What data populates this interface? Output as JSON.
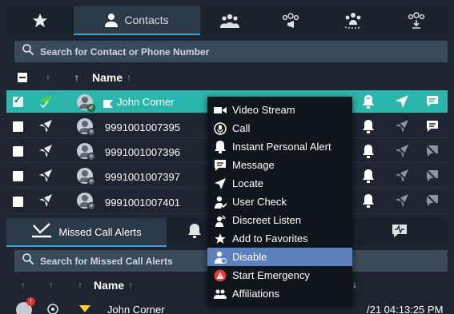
{
  "tabs": [
    {
      "name": "favorites",
      "icon": "star-icon",
      "label": ""
    },
    {
      "name": "contacts",
      "icon": "person-icon",
      "label": "Contacts"
    },
    {
      "name": "groups",
      "icon": "group-icon",
      "label": ""
    },
    {
      "name": "broadcast",
      "icon": "broadcast-group-icon",
      "label": ""
    },
    {
      "name": "dynamic",
      "icon": "dynamic-group-icon",
      "label": ""
    },
    {
      "name": "download",
      "icon": "download-group-icon",
      "label": ""
    }
  ],
  "search": {
    "placeholder": "Search for Contact or Phone Number"
  },
  "header": {
    "name_label": "Name"
  },
  "contacts": [
    {
      "name": "John Corner",
      "selected": true
    },
    {
      "name": "9991001007395",
      "selected": false
    },
    {
      "name": "9991001007396",
      "selected": false
    },
    {
      "name": "9991001007397",
      "selected": false
    },
    {
      "name": "9991001007401",
      "selected": false
    }
  ],
  "menu": {
    "items": [
      {
        "label": "Video Stream",
        "icon": "video-icon"
      },
      {
        "label": "Call",
        "icon": "call-icon"
      },
      {
        "label": "Instant Personal Alert",
        "icon": "bell-icon"
      },
      {
        "label": "Message",
        "icon": "message-icon"
      },
      {
        "label": "Locate",
        "icon": "locate-arrow-icon"
      },
      {
        "label": "User Check",
        "icon": "user-check-icon"
      },
      {
        "label": "Discreet Listen",
        "icon": "discreet-listen-icon"
      },
      {
        "label": "Add to Favorites",
        "icon": "star-icon"
      },
      {
        "label": "Disable",
        "icon": "disable-user-icon"
      },
      {
        "label": "Start Emergency",
        "icon": "emergency-icon"
      },
      {
        "label": "Affiliations",
        "icon": "affiliations-icon"
      }
    ],
    "highlighted": "Disable"
  },
  "missed": {
    "tab_label": "Missed Call Alerts",
    "search_placeholder": "Search for Missed Call Alerts",
    "name_label": "Name",
    "row": {
      "name": "John Corner",
      "time": "/21 04:13:25 PM"
    }
  },
  "colors": {
    "accent": "#3aa0d8",
    "selected_row": "#2bb6ad",
    "menu_highlight": "#5b80bd",
    "emergency": "#e03b3b"
  }
}
